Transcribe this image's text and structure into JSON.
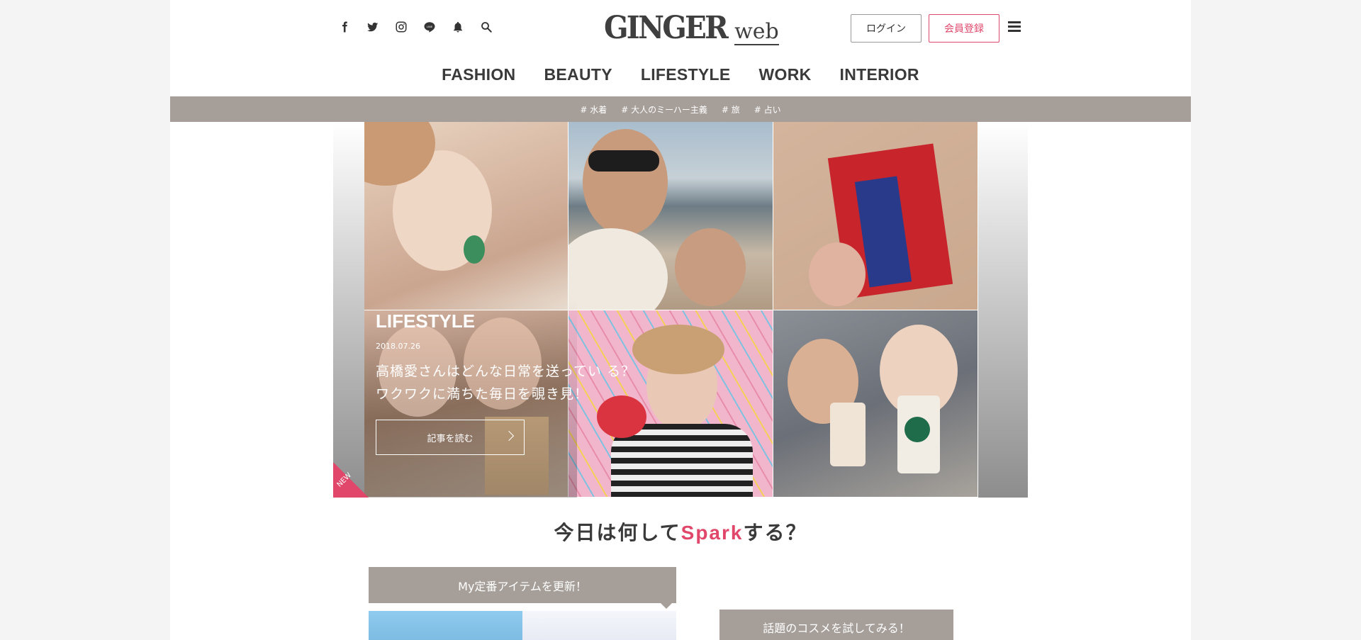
{
  "header": {
    "social": [
      {
        "name": "facebook-icon"
      },
      {
        "name": "twitter-icon"
      },
      {
        "name": "instagram-icon"
      },
      {
        "name": "line-icon"
      },
      {
        "name": "bell-icon"
      },
      {
        "name": "search-icon"
      }
    ],
    "logo_main": "GINGER",
    "logo_sub": "web",
    "login_label": "ログイン",
    "register_label": "会員登録"
  },
  "nav": {
    "items": [
      "FASHION",
      "BEAUTY",
      "LIFESTYLE",
      "WORK",
      "INTERIOR"
    ]
  },
  "tags": [
    "# 水着",
    "# 大人のミーハー主義",
    "# 旅",
    "# 占い"
  ],
  "hero": {
    "category": "LIFESTYLE",
    "date": "2018.07.26",
    "title": "高橋愛さんはどんな日常を送ってい る？ ワクワクに満ちた毎日を覗き見！",
    "button_label": "記事を読む",
    "badge": "NEW"
  },
  "spark": {
    "prefix": "今日は何して",
    "accent": "Spark",
    "suffix": "する？"
  },
  "cards": [
    {
      "label": "My定番アイテムを更新！"
    },
    {
      "label": "話題のコスメを試してみる！"
    }
  ],
  "colors": {
    "accent": "#e0476b",
    "tagbar": "#a59e99"
  }
}
